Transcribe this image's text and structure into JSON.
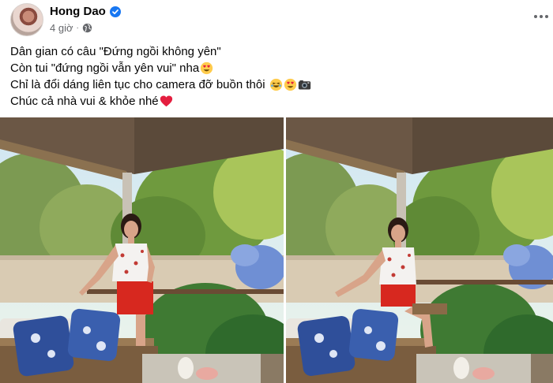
{
  "post": {
    "author": "Hong Dao",
    "timestamp": "4 giờ",
    "separator": "·",
    "privacy_icon": "globe-icon",
    "verified_icon": "verified-badge-icon",
    "more_icon": "more-options-icon",
    "lines": [
      "Dân gian có câu \"Đứng ngồi không yên\"",
      "Còn tui \"đứng ngồi vẫn yên vui\" nha",
      "Chỉ là đổi dáng liên tục cho camera đỡ buồn thôi",
      "Chúc cả nhà vui & khỏe nhé"
    ],
    "emojis": {
      "line2": [
        "heart-eyes-emoji"
      ],
      "line3": [
        "laughing-emoji",
        "heart-eyes-emoji",
        "camera-emoji"
      ],
      "line4": [
        "red-heart-emoji"
      ]
    }
  },
  "photos": [
    {
      "name": "photo-woman-on-patio-1"
    },
    {
      "name": "photo-woman-on-patio-2"
    }
  ],
  "colors": {
    "verified": "#1877f2",
    "secondary_text": "#65676b",
    "heart": "#e41e3f",
    "emoji_yellow": "#ffcc4d"
  }
}
